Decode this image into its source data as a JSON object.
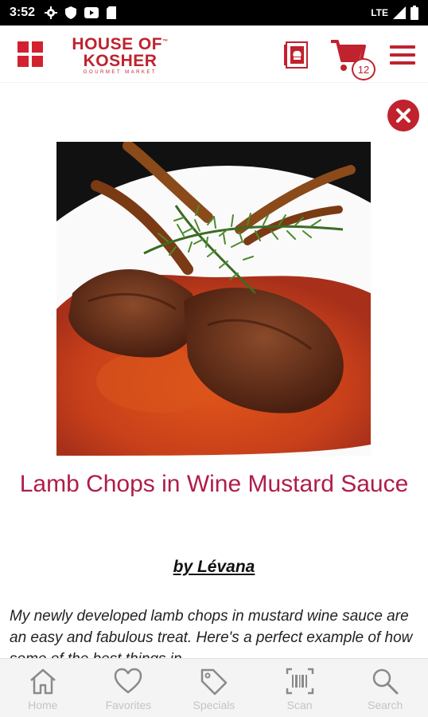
{
  "status_bar": {
    "time": "3:52",
    "network": "LTE",
    "icons": [
      "settings-icon",
      "shield-icon",
      "youtube-icon",
      "sim-icon",
      "signal-icon",
      "battery-icon"
    ]
  },
  "header": {
    "logo_line1": "HOUSE OF",
    "logo_tm": "™",
    "logo_line2": "KOSHER",
    "logo_tagline": "GOURMET MARKET",
    "cart_count": "12",
    "brand_color": "#c0222e"
  },
  "recipe": {
    "title": "Lamb Chops in Wine Mustard Sauce",
    "author": "by Lévana",
    "description": "My newly developed lamb chops in mustard wine sauce are an easy and fabulous treat. Here's a perfect example of how some of the best things in"
  },
  "bottom_nav": {
    "items": [
      {
        "label": "Home",
        "icon": "home-icon"
      },
      {
        "label": "Favorites",
        "icon": "heart-icon"
      },
      {
        "label": "Specials",
        "icon": "tag-icon"
      },
      {
        "label": "Scan",
        "icon": "barcode-scan-icon"
      },
      {
        "label": "Search",
        "icon": "search-icon"
      }
    ]
  }
}
